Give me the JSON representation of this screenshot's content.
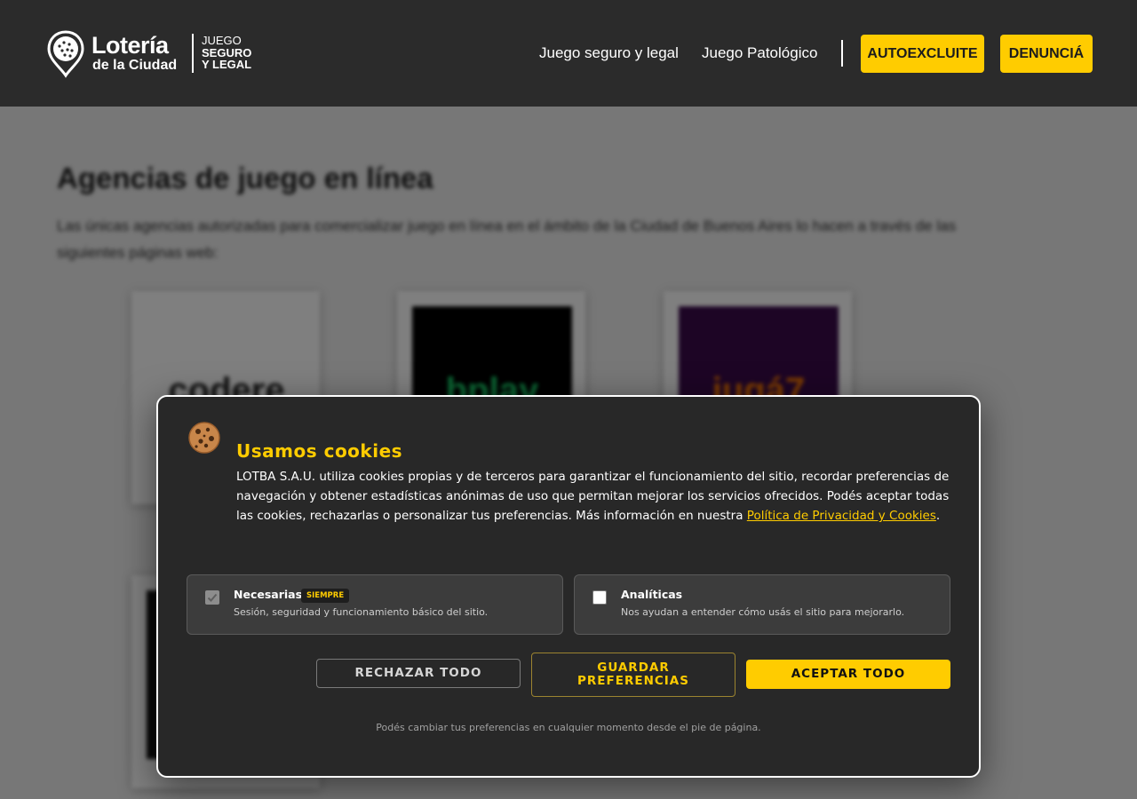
{
  "header": {
    "logo": {
      "main": "Lotería",
      "sub": "de la Ciudad",
      "tag_line1": "JUEGO",
      "tag_line2": "SEGURO",
      "tag_line3": "Y LEGAL"
    },
    "nav": {
      "link1": "Juego seguro y legal",
      "link2": "Juego Patológico"
    },
    "buttons": {
      "self_exclude": "AUTOEXCLUITE",
      "report": "DENUNCIÁ"
    },
    "colors": {
      "background": "#2b2b2b",
      "accent": "#ffcc00"
    }
  },
  "page": {
    "title": "Agencias de juego en línea",
    "intro": "Las únicas agencias autorizadas para comercializar juego en línea en el ámbito de la Ciudad de Buenos Aires lo hacen a través de las siguientes páginas web:",
    "cards": [
      {
        "logo_text": "codere"
      },
      {
        "logo_text": "bplay"
      },
      {
        "logo_text": "jugá7"
      }
    ]
  },
  "cookie_modal": {
    "icon": "cookie-icon",
    "title": "Usamos cookies",
    "description": "LOTBA S.A.U. utiliza cookies propias y de terceros para garantizar el funcionamiento del sitio, recordar preferencias de navegación y obtener estadísticas anónimas de uso que permitan mejorar los servicios ofrecidos. Podés aceptar todas las cookies, rechazarlas o personalizar tus preferencias. Más información en nuestra",
    "policy_link": "Política de Privacidad y Cookies",
    "preferences": {
      "necessary": {
        "name": "Necesarias",
        "badge": "SIEMPRE",
        "description": "Sesión, seguridad y funcionamiento básico del sitio.",
        "checked": true,
        "disabled": true
      },
      "analytics": {
        "name": "Analíticas",
        "description": "Nos ayudan a entender cómo usás el sitio para mejorarlo.",
        "checked": false
      }
    },
    "buttons": {
      "reject": "RECHAZAR TODO",
      "save": "GUARDAR PREFERENCIAS",
      "accept": "ACEPTAR TODO"
    },
    "footer": "Podés cambiar tus preferencias en cualquier momento desde el pie de página.",
    "colors": {
      "background": "#282828",
      "accent": "#ffcc00"
    }
  }
}
